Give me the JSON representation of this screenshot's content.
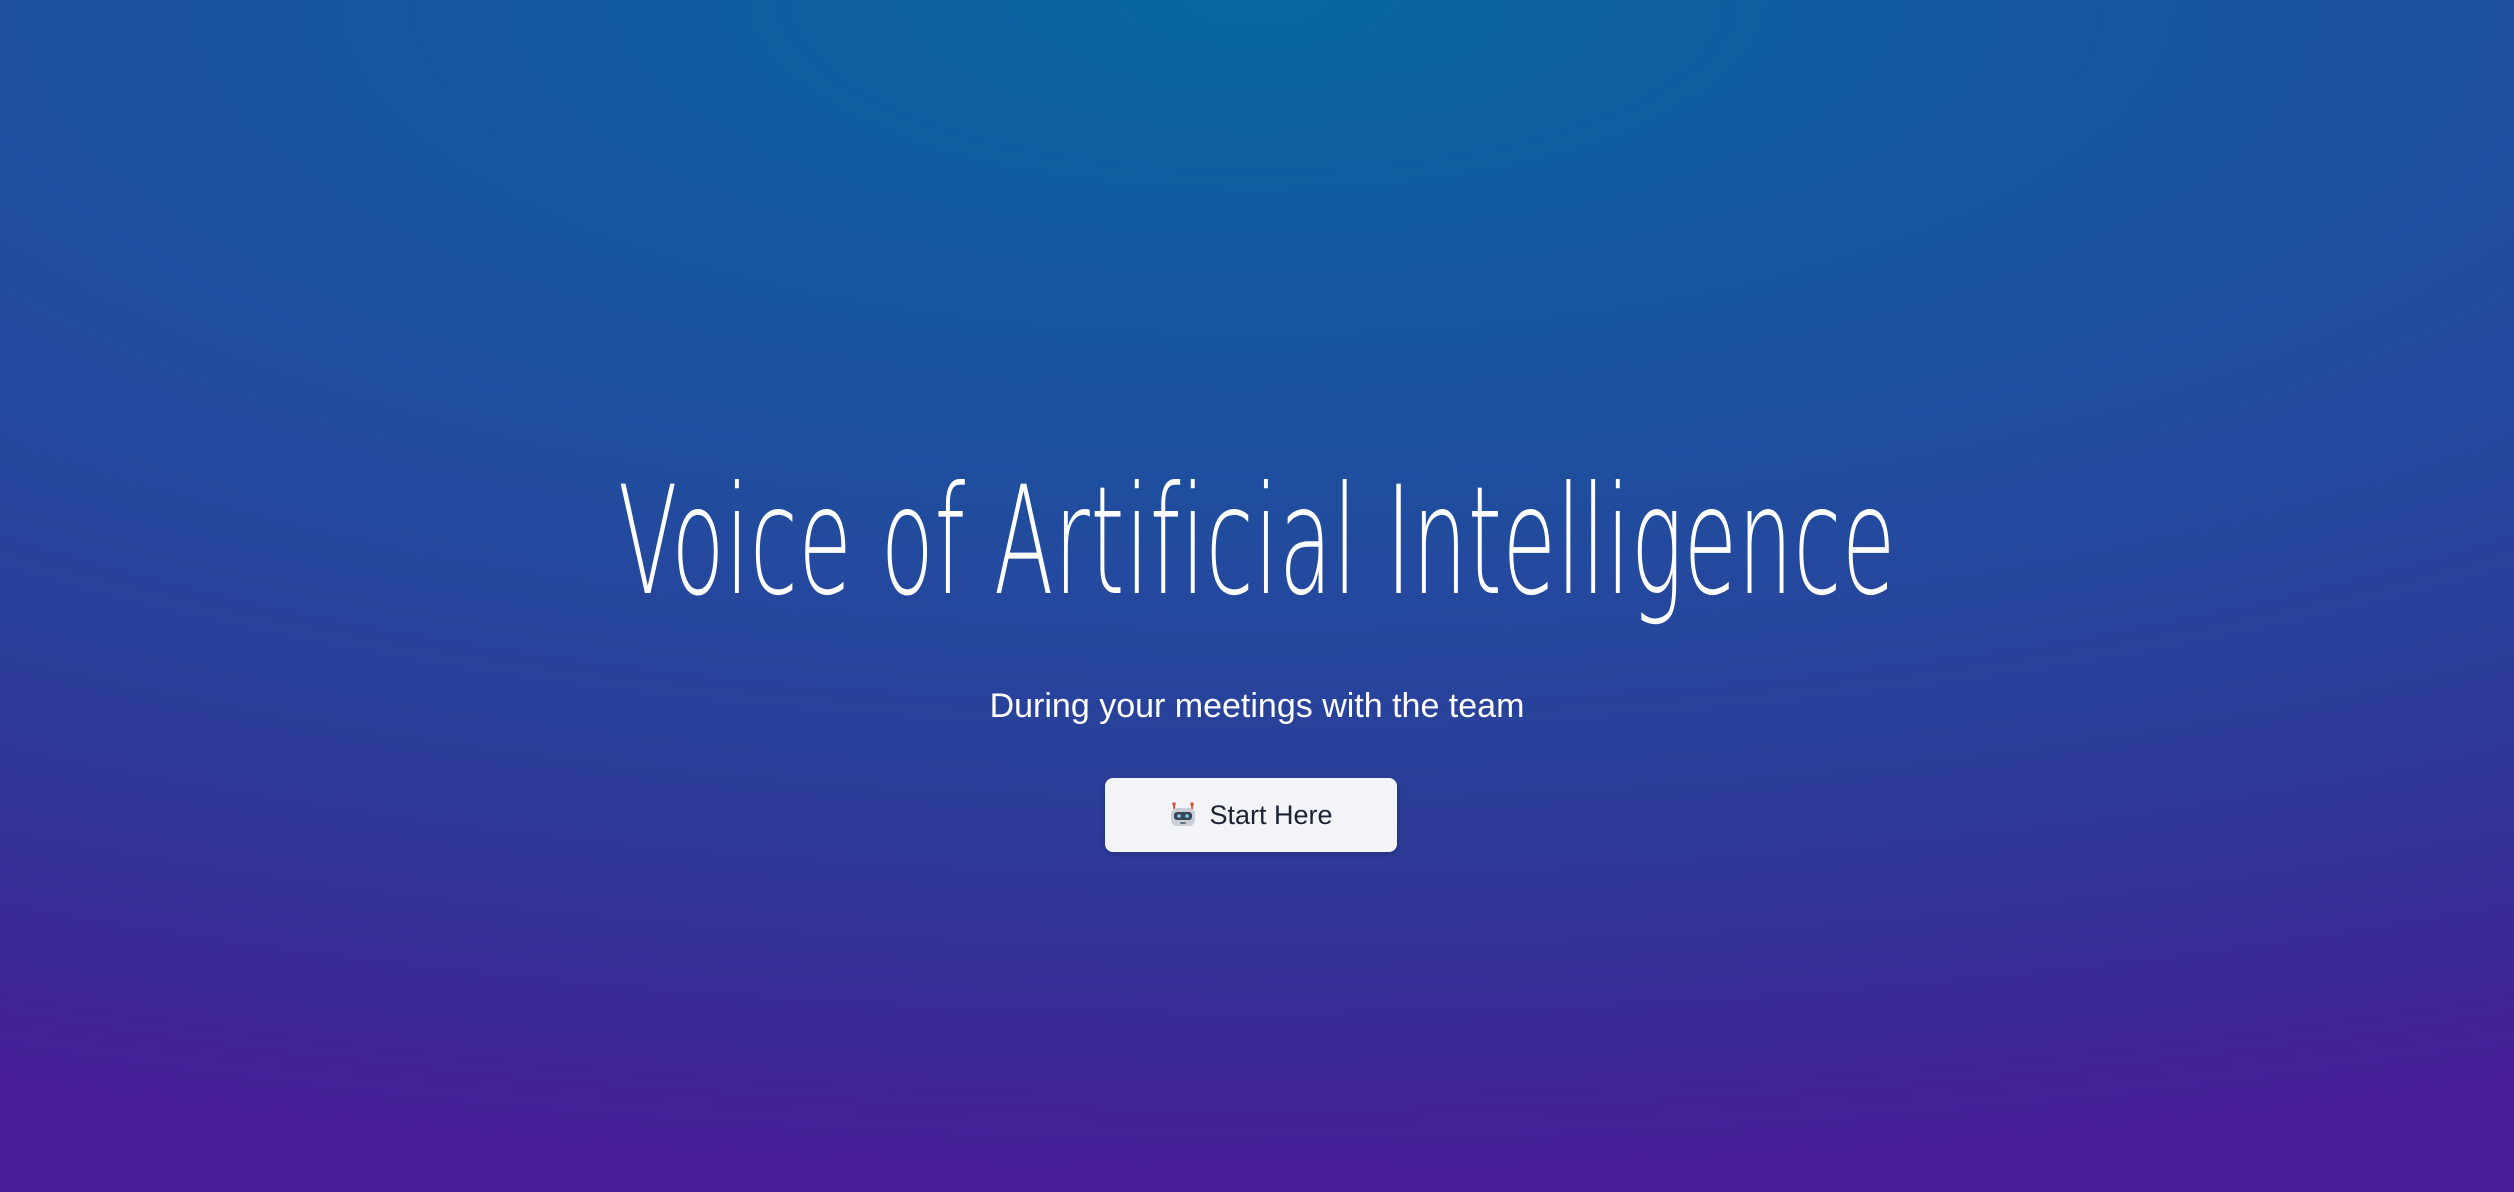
{
  "hero": {
    "title": "Voice of Artificial Intelligence",
    "subtitle": "During your meetings with the team",
    "cta_label": "Start Here",
    "cta_icon": "robot-icon"
  },
  "colors": {
    "background_top": "#06669f",
    "background_mid": "#234a9e",
    "background_bottom": "#4a1d99",
    "button_bg": "#f2f4f8",
    "button_text": "#1c2230",
    "text": "#ffffff"
  }
}
